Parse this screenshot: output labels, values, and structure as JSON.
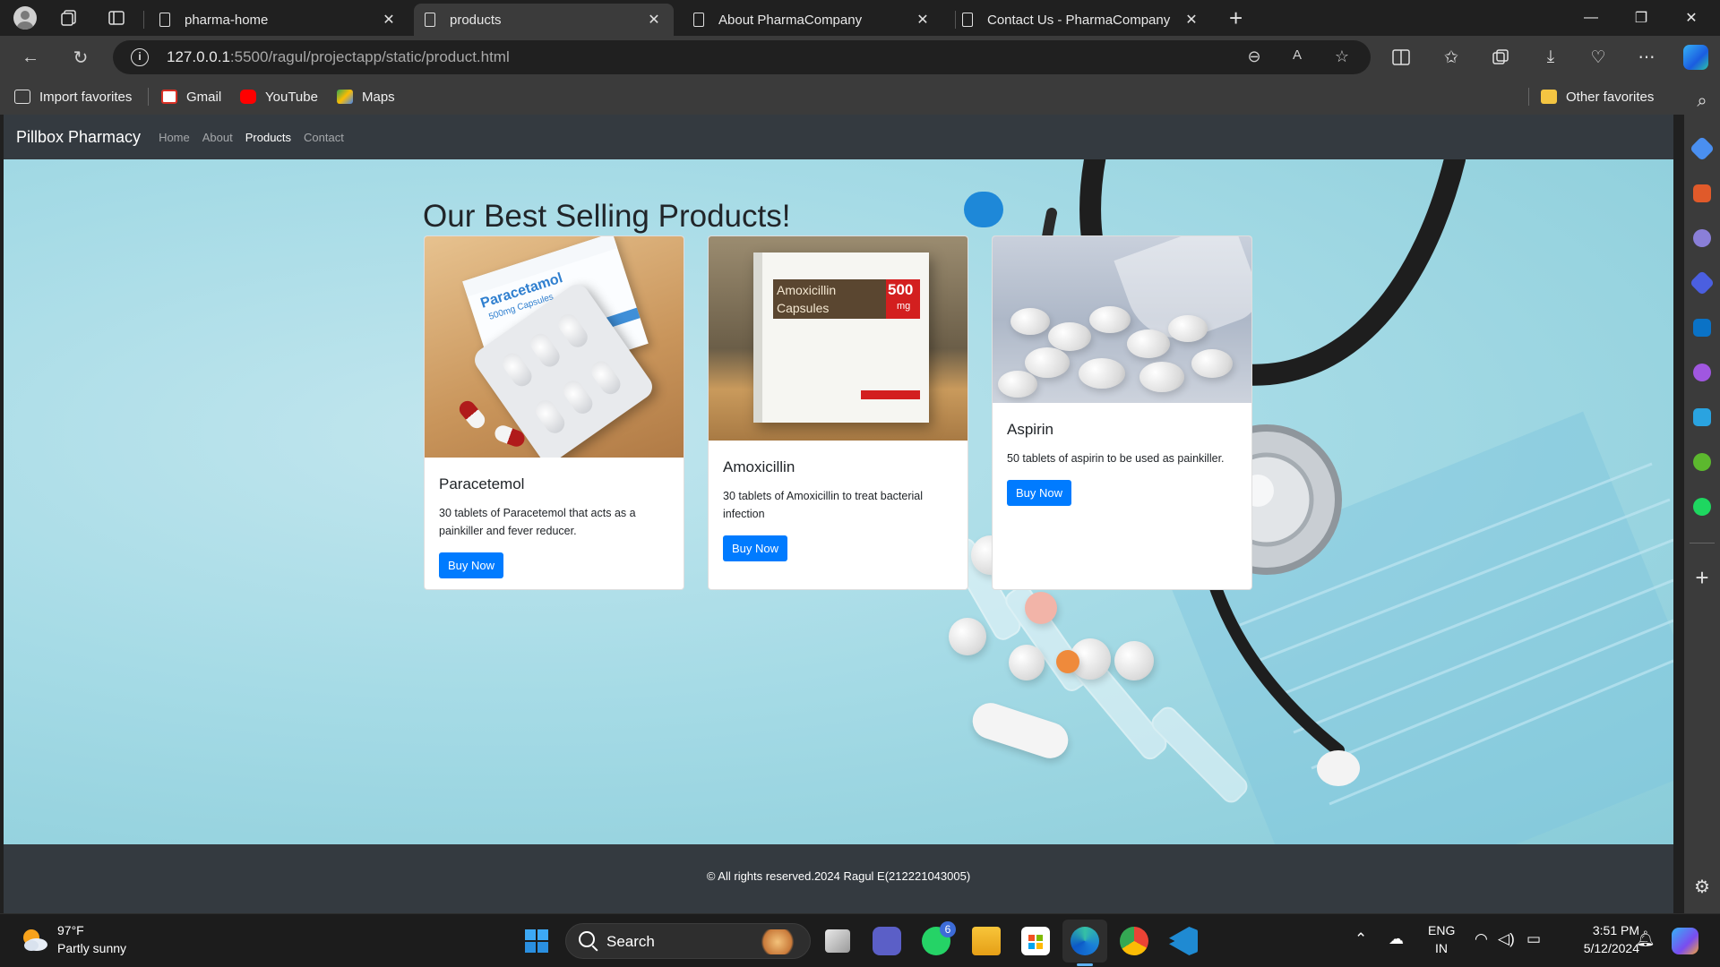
{
  "browser": {
    "tabs": [
      {
        "title": "pharma-home",
        "active": false
      },
      {
        "title": "products",
        "active": true
      },
      {
        "title": "About PharmaCompany",
        "active": false
      },
      {
        "title": "Contact Us - PharmaCompany",
        "active": false
      }
    ],
    "address": {
      "host": "127.0.0.1",
      "path": ":5500/ragul/projectapp/static/product.html"
    },
    "favorites": [
      {
        "label": "Import favorites",
        "icon": "import-icon"
      },
      {
        "label": "Gmail",
        "icon": "gmail-icon",
        "color": "#d93025"
      },
      {
        "label": "YouTube",
        "icon": "youtube-icon",
        "color": "#ff0000"
      },
      {
        "label": "Maps",
        "icon": "maps-icon",
        "color": "#34a853"
      }
    ],
    "other_favorites": "Other favorites"
  },
  "site": {
    "brand": "Pillbox Pharmacy",
    "nav": [
      {
        "label": "Home",
        "active": false
      },
      {
        "label": "About",
        "active": false
      },
      {
        "label": "Products",
        "active": true
      },
      {
        "label": "Contact",
        "active": false
      }
    ],
    "heading": "Our Best Selling Products!",
    "products": [
      {
        "name": "Paracetemol",
        "description": "30 tablets of Paracetemol that acts as a painkiller and fever reducer.",
        "button": "Buy Now",
        "box_label_1": "Paracetamol",
        "box_label_2": "500mg Capsules"
      },
      {
        "name": "Amoxicillin",
        "description": "30 tablets of Amoxicillin to treat bacterial infection",
        "button": "Buy Now",
        "box_label_1": "Amoxicillin",
        "box_label_2": "Capsules",
        "box_strength": "500",
        "box_unit": "mg"
      },
      {
        "name": "Aspirin",
        "description": "50 tablets of aspirin to be used as painkiller.",
        "button": "Buy Now"
      }
    ],
    "footer": "© All rights reserved.2024 Ragul E(212221043005)"
  },
  "taskbar": {
    "weather_temp": "97°F",
    "weather_desc": "Partly sunny",
    "search": "Search",
    "whatsapp_badge": "6",
    "language_1": "ENG",
    "language_2": "IN",
    "time": "3:51 PM",
    "date": "5/12/2024"
  },
  "colors": {
    "primary_button": "#007bff",
    "navbar": "#343a40",
    "browser_chrome": "#3b3b3b"
  }
}
